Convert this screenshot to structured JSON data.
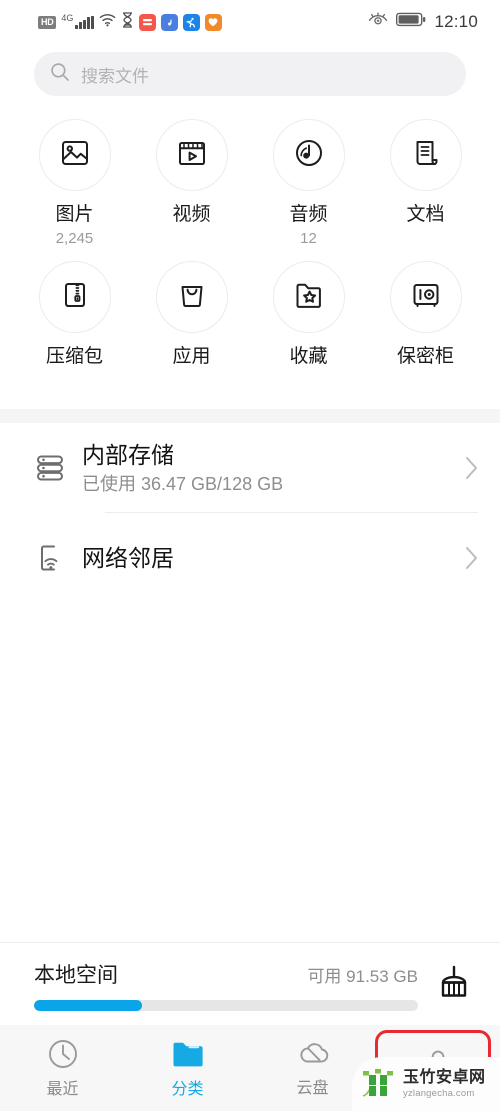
{
  "statusbar": {
    "hd_badge": "HD",
    "network": "4G",
    "icons": [
      "hd-badge",
      "signal-bars-icon",
      "wifi-icon",
      "hourglass-icon",
      "app-red-icon",
      "app-music-icon",
      "app-sports-icon",
      "app-weather-icon"
    ],
    "right_icons": [
      "eye-comfort-icon",
      "battery-icon"
    ],
    "time": "12:10"
  },
  "search": {
    "placeholder": "搜索文件",
    "icon": "search-icon"
  },
  "categories": [
    {
      "label": "图片",
      "count": "2,245",
      "icon": "image-icon"
    },
    {
      "label": "视频",
      "count": "",
      "icon": "video-icon"
    },
    {
      "label": "音频",
      "count": "12",
      "icon": "audio-icon"
    },
    {
      "label": "文档",
      "count": "",
      "icon": "document-icon"
    },
    {
      "label": "压缩包",
      "count": "",
      "icon": "zip-icon"
    },
    {
      "label": "应用",
      "count": "",
      "icon": "apk-bag-icon"
    },
    {
      "label": "收藏",
      "count": "",
      "icon": "favorite-folder-icon"
    },
    {
      "label": "保密柜",
      "count": "",
      "icon": "safe-box-icon"
    }
  ],
  "storage_rows": [
    {
      "title": "内部存储",
      "subtitle": "已使用 36.47 GB/128 GB",
      "icon": "internal-storage-icon",
      "chevron": "chevron-right-icon"
    },
    {
      "title": "网络邻居",
      "subtitle": "",
      "icon": "network-neighbor-icon",
      "chevron": "chevron-right-icon"
    }
  ],
  "local_space": {
    "title": "本地空间",
    "available": "可用 91.53 GB",
    "progress_percent": 28,
    "fill_color": "#0aa5e8",
    "track_color": "#e6e6e8",
    "clean_icon": "broom-clean-icon"
  },
  "bottom_nav": {
    "active_color": "#16aae4",
    "inactive_color": "#8a8a8c",
    "items": [
      {
        "label": "最近",
        "icon": "clock-icon",
        "active": false
      },
      {
        "label": "分类",
        "icon": "folder-icon",
        "active": true
      },
      {
        "label": "云盘",
        "icon": "cloud-icon",
        "active": false
      },
      {
        "label": "",
        "icon": "person-icon",
        "active": false
      }
    ]
  },
  "highlight": {
    "color": "#e8292f",
    "target": "profile-nav-item"
  },
  "watermark": {
    "cn": "玉竹安卓网",
    "en": "yzlangecha.com"
  }
}
